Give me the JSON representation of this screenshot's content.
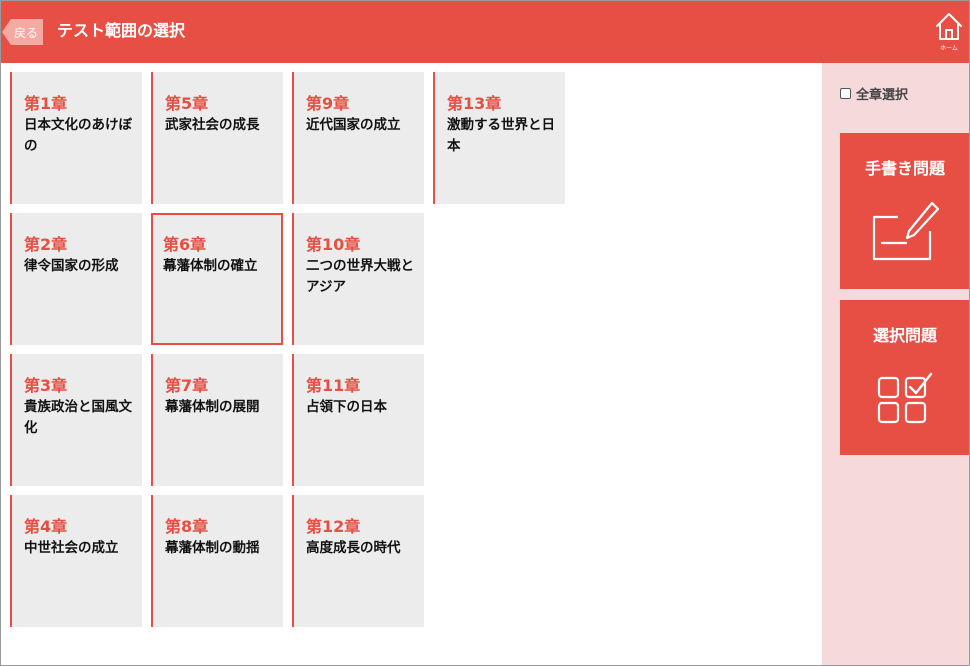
{
  "header": {
    "back_label": "戻る",
    "title": "テスト範囲の選択",
    "home_label": "ホーム"
  },
  "chapters": [
    {
      "number": "第1章",
      "title": "日本文化のあけぼの",
      "selected": false
    },
    {
      "number": "第2章",
      "title": "律令国家の形成",
      "selected": false
    },
    {
      "number": "第3章",
      "title": "貴族政治と国風文化",
      "selected": false
    },
    {
      "number": "第4章",
      "title": "中世社会の成立",
      "selected": false
    },
    {
      "number": "第5章",
      "title": "武家社会の成長",
      "selected": false
    },
    {
      "number": "第6章",
      "title": "幕藩体制の確立",
      "selected": true
    },
    {
      "number": "第7章",
      "title": "幕藩体制の展開",
      "selected": false
    },
    {
      "number": "第8章",
      "title": "幕藩体制の動揺",
      "selected": false
    },
    {
      "number": "第9章",
      "title": "近代国家の成立",
      "selected": false
    },
    {
      "number": "第10章",
      "title": "二つの世界大戦とアジア",
      "selected": false
    },
    {
      "number": "第11章",
      "title": "占領下の日本",
      "selected": false
    },
    {
      "number": "第12章",
      "title": "高度成長の時代",
      "selected": false
    },
    {
      "number": "第13章",
      "title": "激動する世界と日本",
      "selected": false
    }
  ],
  "sidebar": {
    "select_all_label": "全章選択",
    "select_all_checked": false,
    "handwriting_label": "手書き問題",
    "choice_label": "選択問題"
  },
  "colors": {
    "accent": "#e84f44",
    "back_button": "#f4a9a2",
    "card_bg": "#ececec",
    "sidebar_bg": "#f6dadb"
  }
}
